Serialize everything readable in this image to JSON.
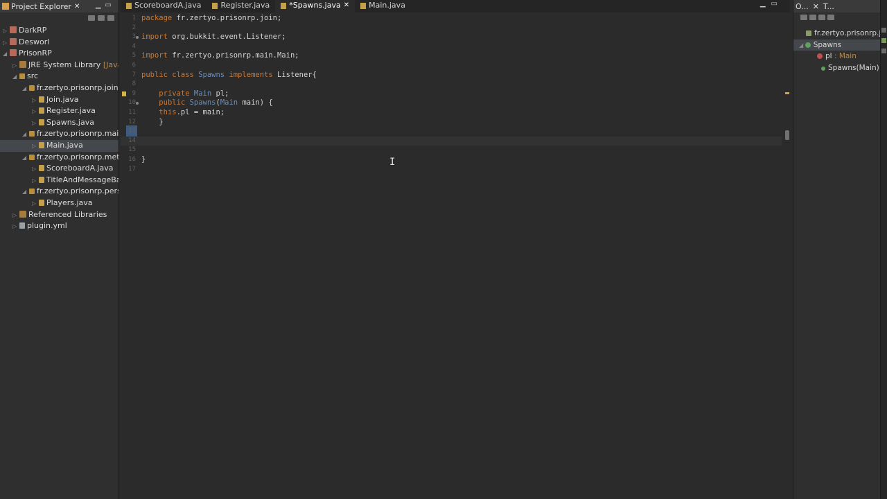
{
  "explorer": {
    "title": "Project Explorer",
    "items": [
      {
        "label": "DarkRP",
        "depth": 0,
        "icon": "project-icon"
      },
      {
        "label": "Desworl",
        "depth": 0,
        "icon": "project-icon"
      },
      {
        "label": "PrisonRP",
        "depth": 0,
        "icon": "project-icon"
      },
      {
        "label": "JRE System Library",
        "suffix": "[JavaSE",
        "depth": 1,
        "icon": "library-icon"
      },
      {
        "label": "src",
        "depth": 1,
        "icon": "source-folder-icon"
      },
      {
        "label": "fr.zertyo.prisonrp.join",
        "depth": 2,
        "icon": "package-icon"
      },
      {
        "label": "Join.java",
        "depth": 3,
        "icon": "java-file-icon"
      },
      {
        "label": "Register.java",
        "depth": 3,
        "icon": "java-file-icon"
      },
      {
        "label": "Spawns.java",
        "depth": 3,
        "icon": "java-file-icon"
      },
      {
        "label": "fr.zertyo.prisonrp.main",
        "depth": 2,
        "icon": "package-icon"
      },
      {
        "label": "Main.java",
        "depth": 3,
        "icon": "java-file-icon",
        "selected": true
      },
      {
        "label": "fr.zertyo.prisonrp.metho",
        "depth": 2,
        "icon": "package-icon"
      },
      {
        "label": "ScoreboardA.java",
        "depth": 3,
        "icon": "java-file-icon"
      },
      {
        "label": "TitleAndMessageBar",
        "depth": 3,
        "icon": "java-file-icon"
      },
      {
        "label": "fr.zertyo.prisonrp.perso",
        "depth": 2,
        "icon": "package-icon"
      },
      {
        "label": "Players.java",
        "depth": 3,
        "icon": "java-file-icon"
      },
      {
        "label": "Referenced Libraries",
        "depth": 1,
        "icon": "library-icon"
      },
      {
        "label": "plugin.yml",
        "depth": 1,
        "icon": "file-icon"
      }
    ]
  },
  "editor": {
    "tabs": [
      {
        "label": "ScoreboardA.java",
        "active": false
      },
      {
        "label": "Register.java",
        "active": false
      },
      {
        "label": "*Spawns.java",
        "active": true
      },
      {
        "label": "Main.java",
        "active": false
      }
    ],
    "lines": [
      {
        "n": "1",
        "text": "package fr.zertyo.prisonrp.join;"
      },
      {
        "n": "2",
        "text": ""
      },
      {
        "n": "3",
        "text": "import org.bukkit.event.Listener;"
      },
      {
        "n": "4",
        "text": ""
      },
      {
        "n": "5",
        "text": "import fr.zertyo.prisonrp.main.Main;"
      },
      {
        "n": "6",
        "text": ""
      },
      {
        "n": "7",
        "text": "public class Spawns implements Listener{"
      },
      {
        "n": "8",
        "text": ""
      },
      {
        "n": "9",
        "text": "    private Main pl;"
      },
      {
        "n": "10",
        "text": "    public Spawns(Main main) {"
      },
      {
        "n": "11",
        "text": "    this.pl = main;"
      },
      {
        "n": "12",
        "text": "    }"
      },
      {
        "n": "13",
        "text": ""
      },
      {
        "n": "14",
        "text": ""
      },
      {
        "n": "15",
        "text": ""
      },
      {
        "n": "16",
        "text": "}"
      },
      {
        "n": "17",
        "text": ""
      }
    ]
  },
  "outline": {
    "tabs": [
      {
        "label": "O..."
      },
      {
        "label": "T..."
      }
    ],
    "package": "fr.zertyo.prisonrp.j",
    "class": "Spawns",
    "field_name": "pl",
    "field_type": ": Main",
    "constructor": "Spawns(Main)"
  }
}
